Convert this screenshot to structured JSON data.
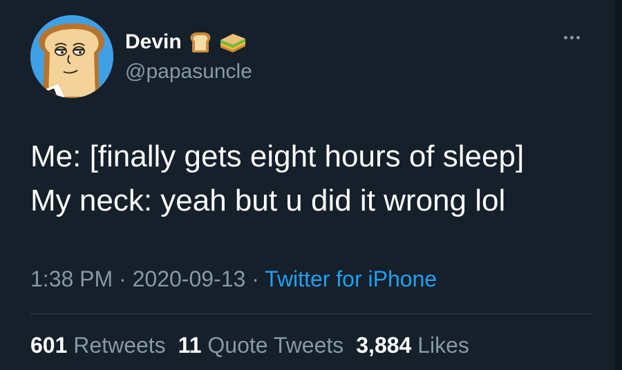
{
  "user": {
    "display_name": "Devin",
    "handle": "@papasuncle",
    "avatar_icon": "toast-cartoon-avatar",
    "name_emojis": [
      "bread-emoji",
      "sandwich-emoji"
    ]
  },
  "tweet": {
    "lines": [
      "Me: [finally gets eight hours of sleep]",
      "My neck: yeah but u did it wrong lol"
    ]
  },
  "meta": {
    "time": "1:38 PM",
    "separator": "·",
    "date": "2020-09-13",
    "source": "Twitter for iPhone"
  },
  "stats": {
    "retweets_count": "601",
    "retweets_label": "Retweets",
    "quotes_count": "11",
    "quotes_label": "Quote Tweets",
    "likes_count": "3,884",
    "likes_label": "Likes"
  },
  "colors": {
    "background": "#15202b",
    "primary_text": "#ffffff",
    "secondary_text": "#8899a6",
    "link": "#1da1f2",
    "divider": "#38444d"
  }
}
